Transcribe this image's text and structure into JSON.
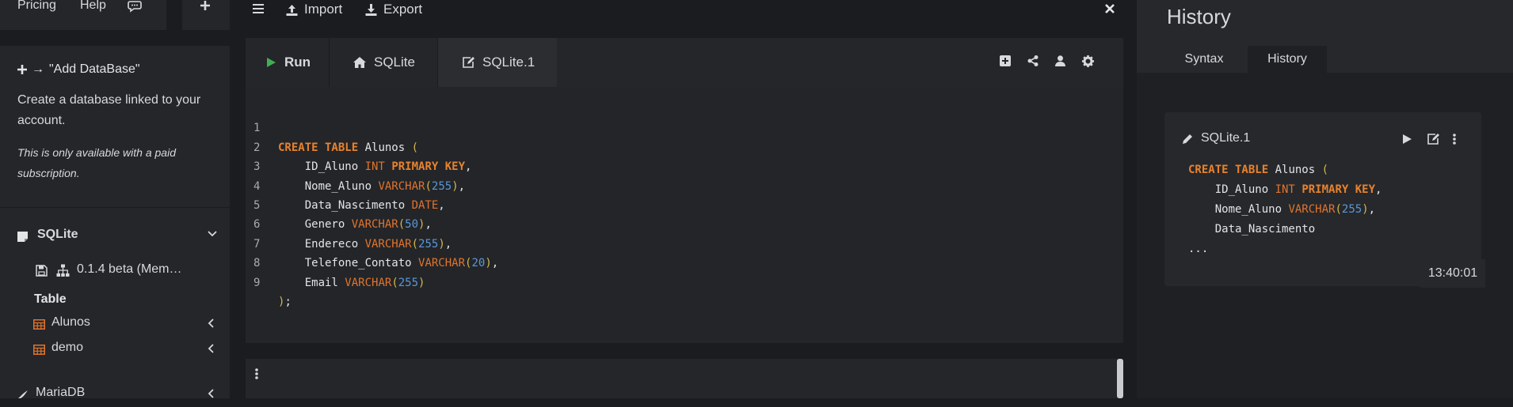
{
  "top_nav": {
    "pricing": "Pricing",
    "help": "Help",
    "chat_icon": "chat-icon",
    "plus_icon": "plus-icon"
  },
  "add_db": {
    "title": "\"Add DataBase\"",
    "arrow": "→",
    "description": "Create a database linked to your account.",
    "note": "This is only available with a paid subscription."
  },
  "db_tree": {
    "sqlite_label": "SQLite",
    "version": "0.1.4 beta (Mem…",
    "table_heading": "Table",
    "tables": [
      "Alunos",
      "demo"
    ],
    "mariadb_label": "MariaDB"
  },
  "toolbar": {
    "import": "Import",
    "export": "Export"
  },
  "editor_tabs": {
    "run": "Run",
    "sqlite": "SQLite",
    "sqlite1": "SQLite.1"
  },
  "code": {
    "line_numbers": [
      "1",
      "2",
      "3",
      "4",
      "5",
      "6",
      "7",
      "8",
      "9"
    ],
    "l1": {
      "kw": "CREATE TABLE",
      "name": " Alunos ",
      "open": "("
    },
    "l2": {
      "col": "    ID_Aluno ",
      "type": "INT",
      "kw": "PRIMARY KEY",
      "end": ","
    },
    "l3": {
      "col": "    Nome_Aluno ",
      "type": "VARCHAR",
      "open": "(",
      "num": "255",
      "close": ")",
      "end": ","
    },
    "l4": {
      "col": "    Data_Nascimento ",
      "type": "DATE",
      "end": ","
    },
    "l5": {
      "col": "    Genero ",
      "type": "VARCHAR",
      "open": "(",
      "num": "50",
      "close": ")",
      "end": ","
    },
    "l6": {
      "col": "    Endereco ",
      "type": "VARCHAR",
      "open": "(",
      "num": "255",
      "close": ")",
      "end": ","
    },
    "l7": {
      "col": "    Telefone_Contato ",
      "type": "VARCHAR",
      "open": "(",
      "num": "20",
      "close": ")",
      "end": ","
    },
    "l8": {
      "col": "    Email ",
      "type": "VARCHAR",
      "open": "(",
      "num": "255",
      "close": ")",
      "end": ""
    },
    "l9": {
      "close": ")",
      "end": ";"
    }
  },
  "right_panel": {
    "title": "History",
    "tabs": [
      "Syntax",
      "History"
    ],
    "active_tab": "History",
    "entry": {
      "title": "SQLite.1",
      "time": "13:40:01",
      "ellipsis": "..."
    }
  },
  "colors": {
    "background": "#1b1c1f",
    "panel": "#24262a",
    "keyword": "#e8822d",
    "number": "#5a98d6",
    "paren": "#d4b94a",
    "run_green": "#3fae52",
    "table_icon": "#e0742c"
  }
}
